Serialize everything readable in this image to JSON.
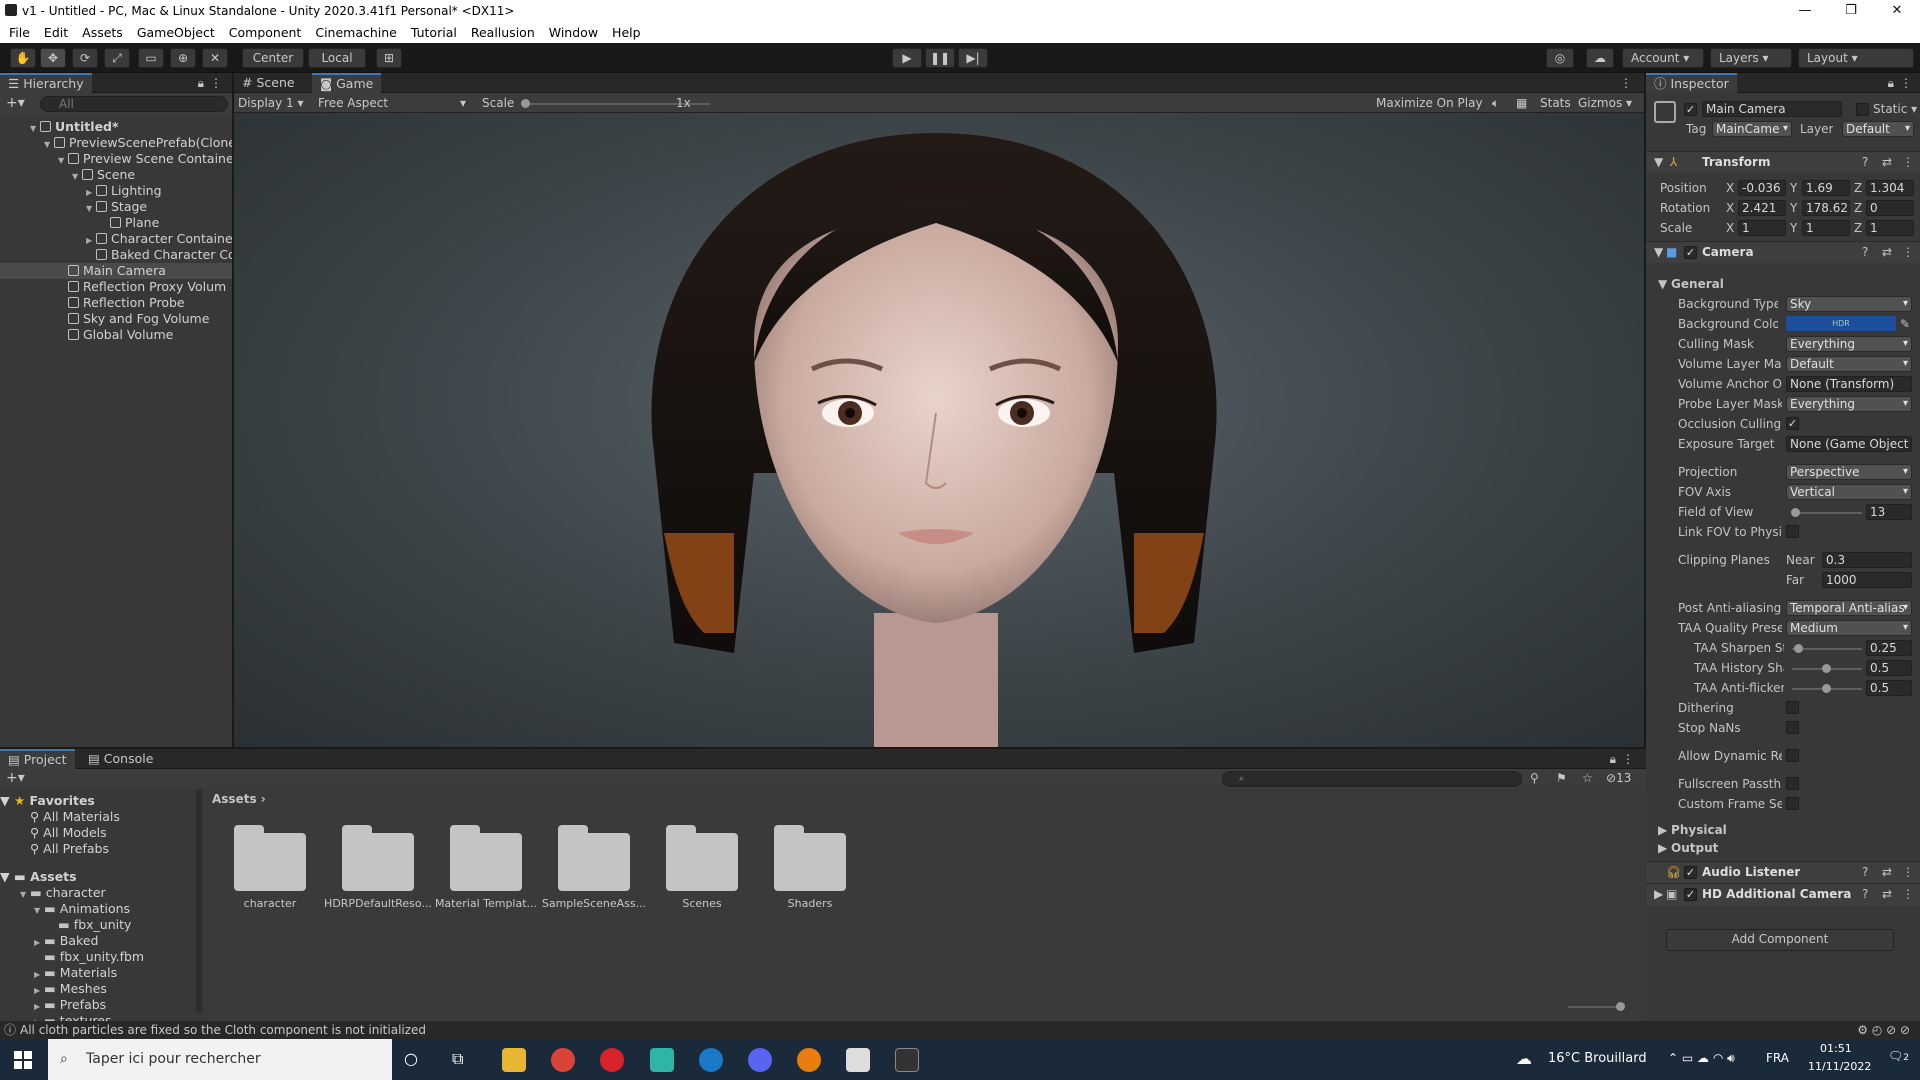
{
  "title": "v1 - Untitled - PC, Mac & Linux Standalone - Unity 2020.3.41f1 Personal* <DX11>",
  "menu": [
    "File",
    "Edit",
    "Assets",
    "GameObject",
    "Component",
    "Cinemachine",
    "Tutorial",
    "Reallusion",
    "Window",
    "Help"
  ],
  "toolbar": {
    "center": "Center",
    "local": "Local",
    "account": "Account",
    "layers": "Layers",
    "layout": "Layout"
  },
  "hierarchy": {
    "tab": "Hierarchy",
    "search": "All",
    "items": [
      {
        "label": "Untitled*",
        "indent": 0,
        "arrow": "▼",
        "bold": true
      },
      {
        "label": "PreviewScenePrefab(Clone",
        "indent": 1,
        "arrow": "▼"
      },
      {
        "label": "Preview Scene Containe",
        "indent": 2,
        "arrow": "▼"
      },
      {
        "label": "Scene",
        "indent": 3,
        "arrow": "▼"
      },
      {
        "label": "Lighting",
        "indent": 4,
        "arrow": "▶"
      },
      {
        "label": "Stage",
        "indent": 4,
        "arrow": "▼"
      },
      {
        "label": "Plane",
        "indent": 5,
        "arrow": ""
      },
      {
        "label": "Character Container",
        "indent": 4,
        "arrow": "▶"
      },
      {
        "label": "Baked Character Co",
        "indent": 4,
        "arrow": ""
      },
      {
        "label": "Main Camera",
        "indent": 2,
        "arrow": "",
        "selected": true
      },
      {
        "label": "Reflection Proxy Volum",
        "indent": 2,
        "arrow": ""
      },
      {
        "label": "Reflection Probe",
        "indent": 2,
        "arrow": ""
      },
      {
        "label": "Sky and Fog Volume",
        "indent": 2,
        "arrow": ""
      },
      {
        "label": "Global Volume",
        "indent": 2,
        "arrow": ""
      }
    ]
  },
  "gameview": {
    "tabs": [
      "Scene",
      "Game"
    ],
    "display": "Display 1",
    "aspect": "Free Aspect",
    "scale_label": "Scale",
    "scale_value": "1x",
    "maximize": "Maximize On Play",
    "stats": "Stats",
    "gizmos": "Gizmos"
  },
  "inspector": {
    "tab": "Inspector",
    "object": "Main Camera",
    "static": "Static",
    "tag_label": "Tag",
    "tag": "MainCame",
    "layer_label": "Layer",
    "layer": "Default",
    "transform": {
      "title": "Transform",
      "rows": [
        {
          "label": "Position",
          "x": "-0.036",
          "y": "1.69",
          "z": "1.304"
        },
        {
          "label": "Rotation",
          "x": "2.421",
          "y": "178.625",
          "z": "0"
        },
        {
          "label": "Scale",
          "x": "1",
          "y": "1",
          "z": "1"
        }
      ]
    },
    "camera": {
      "title": "Camera",
      "general": "General",
      "bg_type_l": "Background Type",
      "bg_type": "Sky",
      "bg_color_l": "Background Color",
      "hdr": "HDR",
      "culling_l": "Culling Mask",
      "culling": "Everything",
      "vol_layer_l": "Volume Layer Mas",
      "vol_layer": "Default",
      "vol_anchor_l": "Volume Anchor Ov",
      "vol_anchor": "None (Transform)",
      "probe_l": "Probe Layer Mask",
      "probe": "Everything",
      "occlusion_l": "Occlusion Culling",
      "exposure_l": "Exposure Target",
      "exposure": "None (Game Object",
      "projection_l": "Projection",
      "projection": "Perspective",
      "fov_axis_l": "FOV Axis",
      "fov_axis": "Vertical",
      "fov_l": "Field of View",
      "fov": "13",
      "link_fov_l": "Link FOV to Physic",
      "clip_l": "Clipping Planes",
      "near_l": "Near",
      "near": "0.3",
      "far_l": "Far",
      "far": "1000",
      "aa_l": "Post Anti-aliasing",
      "aa": "Temporal Anti-alias",
      "taa_q_l": "TAA Quality Prese",
      "taa_q": "Medium",
      "taa_sharp_l": "TAA Sharpen St",
      "taa_sharp": "0.25",
      "taa_hist_l": "TAA History Sha",
      "taa_hist": "0.5",
      "taa_anti_l": "TAA Anti-flicker",
      "taa_anti": "0.5",
      "dither_l": "Dithering",
      "nans_l": "Stop NaNs",
      "dynres_l": "Allow Dynamic Re",
      "fullscreen_l": "Fullscreen Passthr",
      "customframe_l": "Custom Frame Set",
      "physical": "Physical",
      "output": "Output"
    },
    "audio": "Audio Listener",
    "hdcam": "HD Additional Camera Da",
    "add_component": "Add Component"
  },
  "project": {
    "tabs": [
      "Project",
      "Console"
    ],
    "badge": "13",
    "favorites": {
      "title": "Favorites",
      "items": [
        "All Materials",
        "All Models",
        "All Prefabs"
      ]
    },
    "tree_title": "Assets",
    "tree": [
      {
        "label": "character",
        "indent": 1,
        "arrow": "▼"
      },
      {
        "label": "Animations",
        "indent": 2,
        "arrow": "▼"
      },
      {
        "label": "fbx_unity",
        "indent": 3,
        "arrow": ""
      },
      {
        "label": "Baked",
        "indent": 2,
        "arrow": "▶"
      },
      {
        "label": "fbx_unity.fbm",
        "indent": 2,
        "arrow": ""
      },
      {
        "label": "Materials",
        "indent": 2,
        "arrow": "▶"
      },
      {
        "label": "Meshes",
        "indent": 2,
        "arrow": "▶"
      },
      {
        "label": "Prefabs",
        "indent": 2,
        "arrow": "▶"
      },
      {
        "label": "textures",
        "indent": 2,
        "arrow": "▶"
      }
    ],
    "breadcrumb": "Assets",
    "folders": [
      "character",
      "HDRPDefaultReso...",
      "Material Templat...",
      "SampleSceneAss...",
      "Scenes",
      "Shaders"
    ]
  },
  "status": "All cloth particles are fixed so the Cloth component is not initialized",
  "taskbar": {
    "search": "Taper ici pour rechercher",
    "weather": "16°C  Brouillard",
    "lang": "FRA",
    "time": "01:51",
    "date": "11/11/2022",
    "notif": "2"
  },
  "colors": {
    "accent": "#3a79bb",
    "bg_color": "#1f4e9c"
  }
}
